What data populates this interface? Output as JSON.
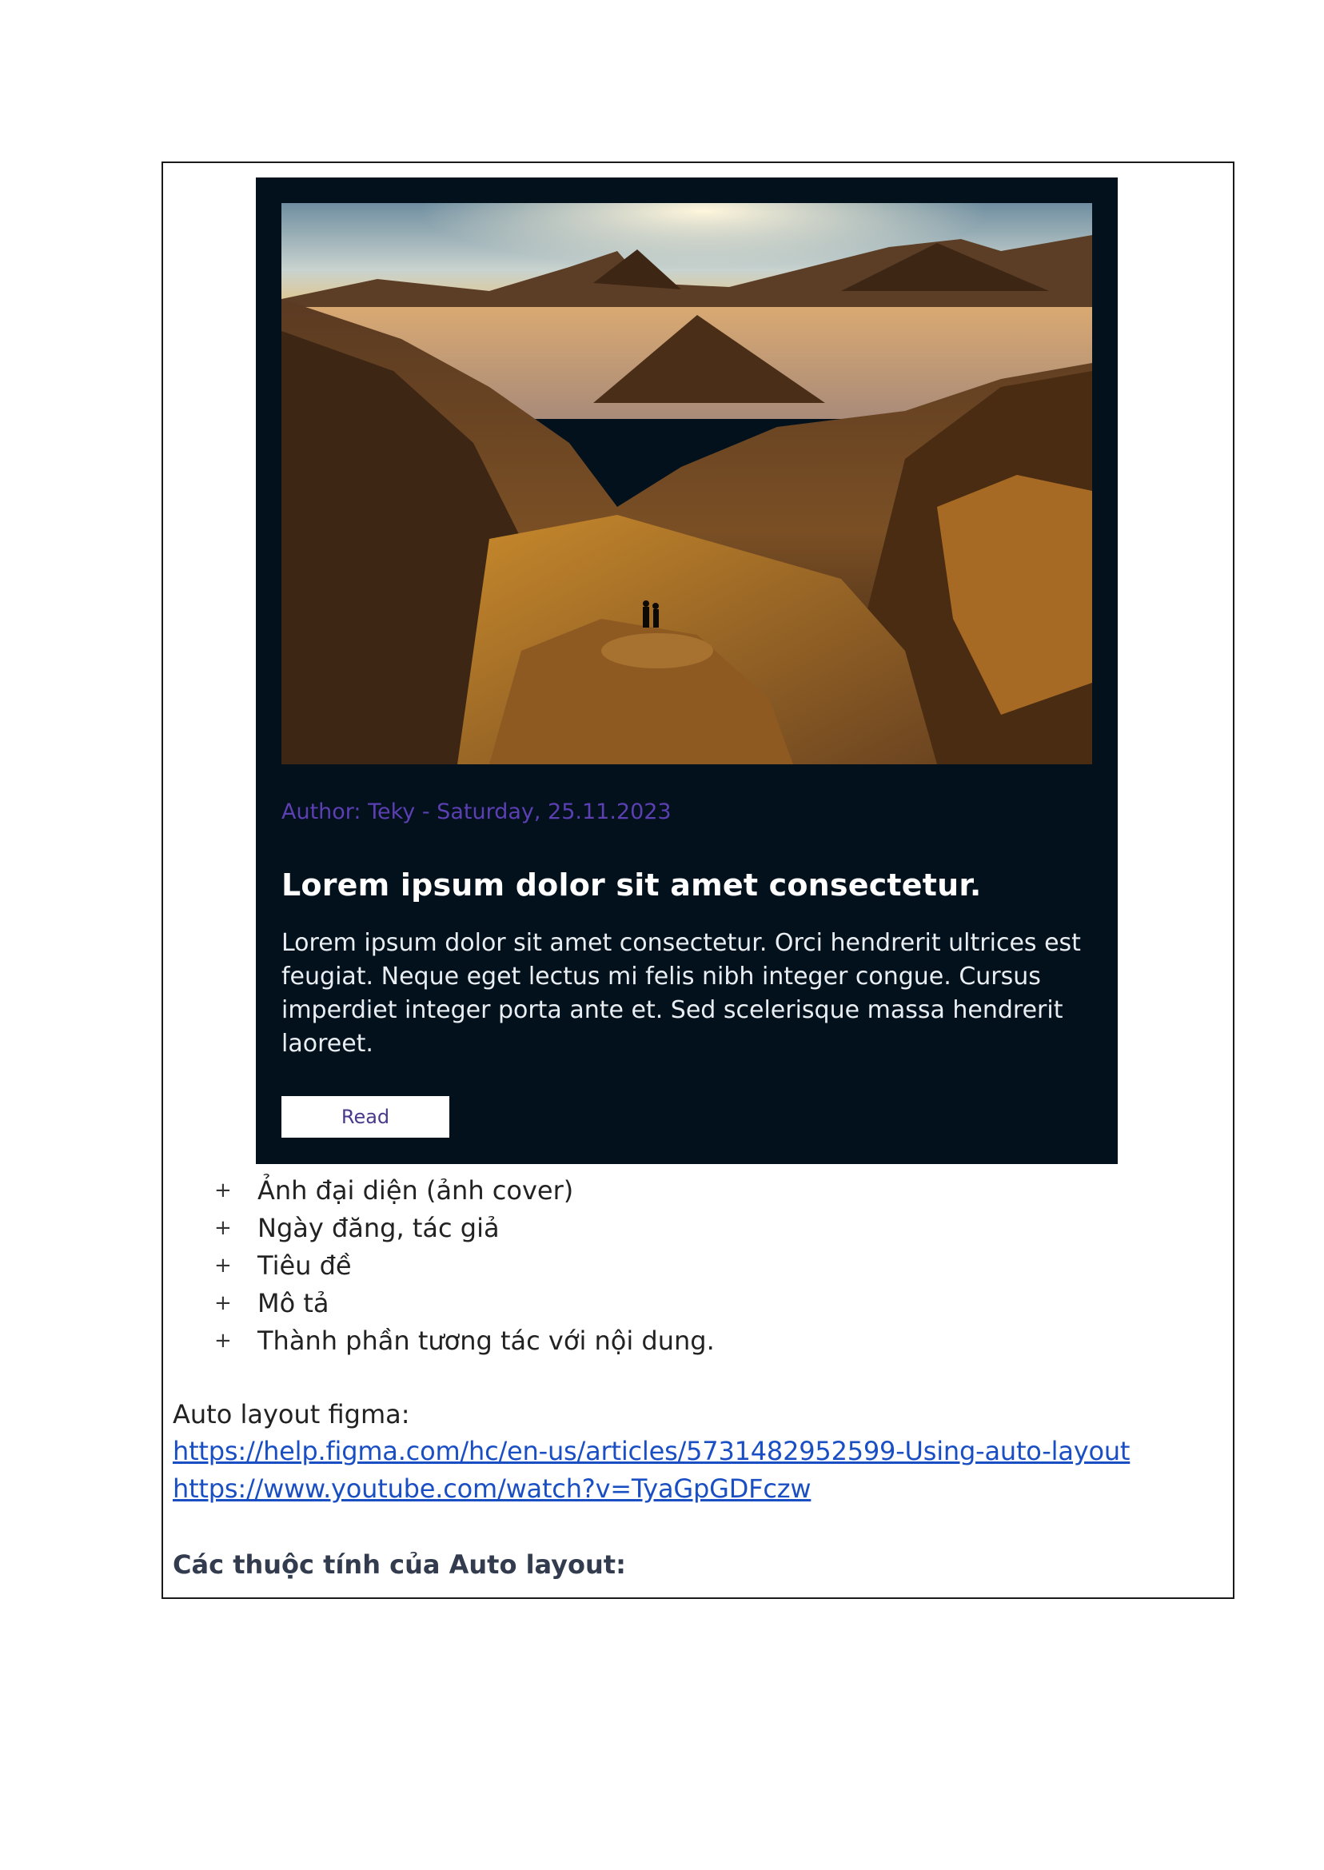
{
  "card": {
    "meta": "Author: Teky - Saturday, 25.11.2023",
    "title": "Lorem ipsum dolor sit amet consectetur.",
    "description": "Lorem ipsum dolor sit amet consectetur. Orci hendrerit ultrices est feugiat. Neque eget lectus mi felis nibh integer congue. Cursus imperdiet integer porta ante et. Sed scelerisque massa hendrerit laoreet.",
    "button_label": "Read",
    "colors": {
      "background": "#03111d",
      "meta": "#5b3fb3",
      "button_text": "#4a3a8c"
    }
  },
  "list": {
    "bullet": "+",
    "items": [
      {
        "text": "Ảnh đại diện (ảnh cover)"
      },
      {
        "text": "Ngày đăng, tác giả"
      },
      {
        "text": "Tiêu đề"
      },
      {
        "text": "Mô tả"
      },
      {
        "text": "Thành phần tương tác với nội dung."
      }
    ]
  },
  "auto_layout": {
    "label": "Auto layout figma:",
    "link1": "https://help.figma.com/hc/en-us/articles/5731482952599-Using-auto-layout",
    "link2": "https://www.youtube.com/watch?v=TyaGpGDFczw"
  },
  "properties_heading": "Các thuộc tính của Auto layout:"
}
